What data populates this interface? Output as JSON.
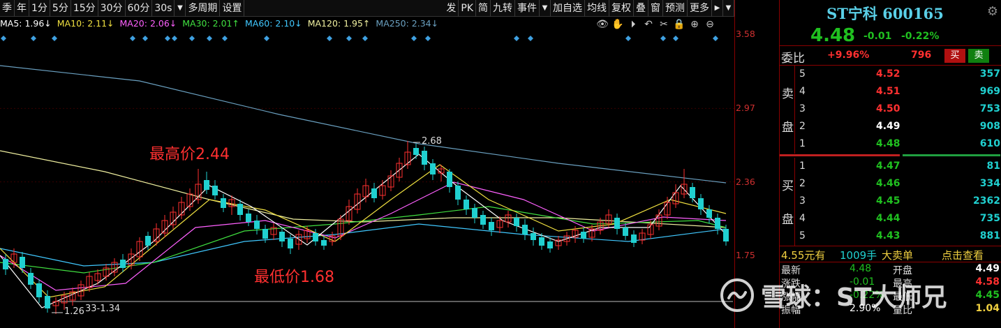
{
  "toolbar": {
    "left": [
      "季",
      "年",
      "1分",
      "5分",
      "15分",
      "30分",
      "60分",
      "30s",
      "▼",
      "多周期",
      "设置"
    ],
    "right": [
      "发",
      "PK",
      "简",
      "九转",
      "事件",
      "▼",
      "加自选",
      "均线",
      "复权",
      "叠",
      "窗",
      "预测",
      "更多",
      "▶",
      "▼"
    ]
  },
  "ma_legend": [
    {
      "label": "MA5: 1.96↓",
      "color": "#ffffff"
    },
    {
      "label": "MA10: 2.11↓",
      "color": "#f0e040"
    },
    {
      "label": "MA20: 2.06↓",
      "color": "#ff60ff"
    },
    {
      "label": "MA30: 2.01↑",
      "color": "#40e040"
    },
    {
      "label": "MA60: 2.10↓",
      "color": "#40c8ff"
    },
    {
      "label": "MA120: 1.95↑",
      "color": "#f0f0a0"
    },
    {
      "label": "MA250: 2.34↓",
      "color": "#6aa0c0"
    }
  ],
  "tool_icons": [
    "eye-icon",
    "hand-icon",
    "play-icon",
    "undo-icon",
    "scissors-icon",
    "lock-icon",
    "zoom-in-icon",
    "zoom-out-icon"
  ],
  "tool_glyphs": [
    "👁",
    "✋",
    "⏵",
    "↶",
    "✂",
    "🔒",
    "⊕",
    "⊖"
  ],
  "y_axis": [
    "3.58",
    "2.97",
    "2.36",
    "1.75"
  ],
  "annotations": {
    "high": "最高价2.44",
    "low": "最低价1.68",
    "peak_label": "2.68",
    "low_label": "1.26",
    "range_label": "33-1.34"
  },
  "quote": {
    "title": "ST宁科 600165",
    "price": "4.48",
    "change": "-0.01",
    "change_pct": "-0.22%",
    "wb_label": "委比",
    "wb_pct": "+9.96%",
    "wb_num": "796",
    "buy_btn": "买",
    "sell_btn": "卖",
    "sell_side": "卖盘",
    "buy_side": "买盘",
    "asks": [
      {
        "n": "5",
        "p": "4.52",
        "v": "357",
        "c": "#ff3030"
      },
      {
        "n": "4",
        "p": "4.51",
        "v": "969",
        "c": "#ff3030"
      },
      {
        "n": "3",
        "p": "4.50",
        "v": "753",
        "c": "#ff3030"
      },
      {
        "n": "2",
        "p": "4.49",
        "v": "908",
        "c": "#ffffff"
      },
      {
        "n": "1",
        "p": "4.48",
        "v": "610",
        "c": "#20c020"
      }
    ],
    "bids": [
      {
        "n": "1",
        "p": "4.47",
        "v": "81",
        "c": "#20c020"
      },
      {
        "n": "2",
        "p": "4.46",
        "v": "334",
        "c": "#20c020"
      },
      {
        "n": "3",
        "p": "4.45",
        "v": "2362",
        "c": "#20c020"
      },
      {
        "n": "4",
        "p": "4.44",
        "v": "735",
        "c": "#20c020"
      },
      {
        "n": "5",
        "p": "4.43",
        "v": "881",
        "c": "#20c020"
      }
    ],
    "deal": {
      "a": "4.55元有",
      "b": "1009手",
      "c": "大卖单",
      "d": "点击查看"
    },
    "stats": [
      {
        "l": "最新",
        "v": "4.48",
        "vc": "#20c020",
        "l2": "开盘",
        "v2": "4.49",
        "v2c": "#ffffff"
      },
      {
        "l": "涨跌",
        "v": "-0.01",
        "vc": "#20c020",
        "l2": "最高",
        "v2": "4.58",
        "v2c": "#ff3030"
      },
      {
        "l": "涨幅",
        "v": "-0.22%",
        "vc": "#20c020",
        "l2": "最低",
        "v2": "4.45",
        "v2c": "#20c020"
      },
      {
        "l": "振幅",
        "v": "2.90%",
        "vc": "#ffffff",
        "l2": "量比",
        "v2": "1.04",
        "v2c": "#f0d040"
      }
    ]
  },
  "watermark": "雪球：ST大师兄"
}
